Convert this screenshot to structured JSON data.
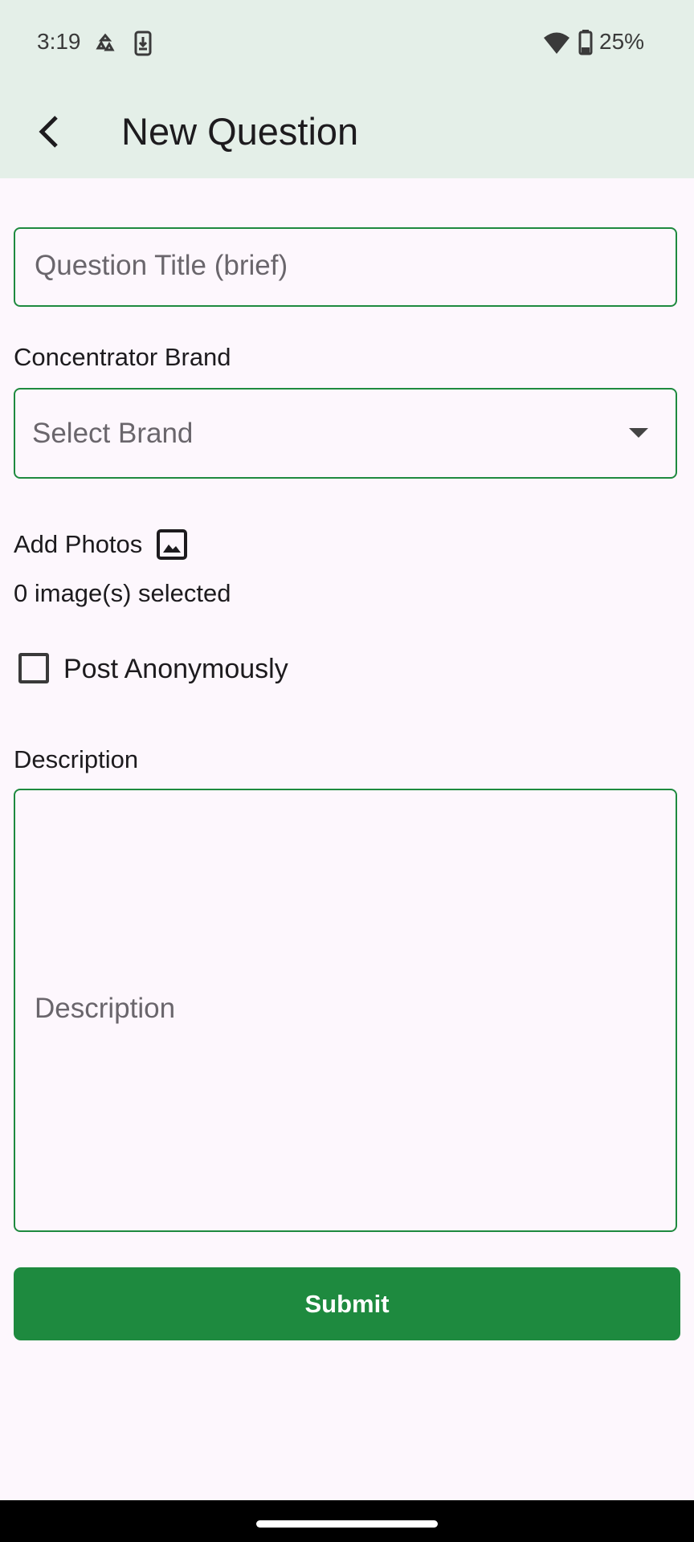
{
  "status_bar": {
    "time": "3:19",
    "battery": "25%",
    "icons": [
      "sync-icon",
      "download-icon",
      "wifi-icon",
      "battery-icon"
    ]
  },
  "app_bar": {
    "title": "New Question",
    "back_icon": "chevron-left-icon"
  },
  "form": {
    "title_placeholder": "Question Title (brief)",
    "brand_label": "Concentrator Brand",
    "brand_placeholder": "Select Brand",
    "photos_label": "Add Photos",
    "photos_icon": "image-icon",
    "images_selected": "0 image(s) selected",
    "anonymous_label": "Post Anonymously",
    "anonymous_checked": false,
    "description_label": "Description",
    "description_placeholder": "Description",
    "submit_label": "Submit"
  },
  "colors": {
    "accent": "#1e8a3f",
    "app_bar_bg": "#e4efe8",
    "page_bg": "#fdf7fd"
  }
}
